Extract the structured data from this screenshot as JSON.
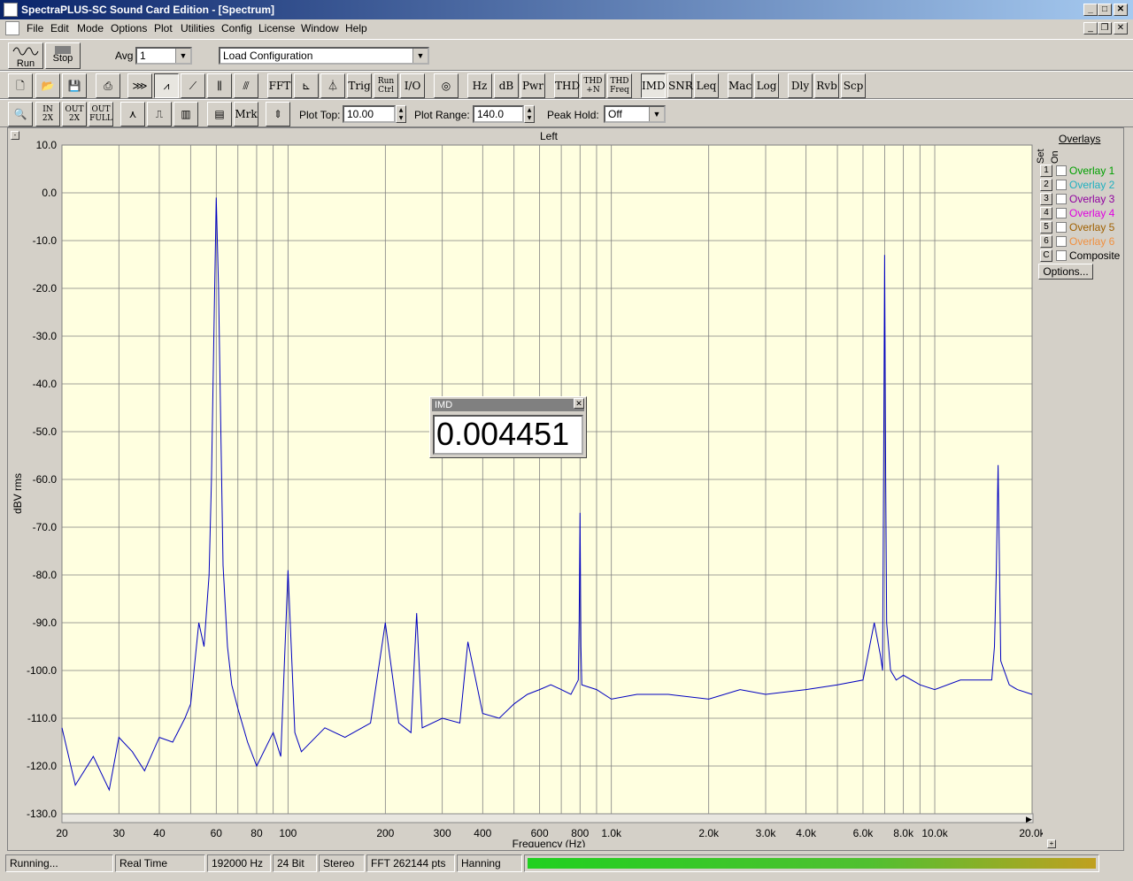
{
  "window": {
    "title": "SpectraPLUS-SC Sound Card Edition - [Spectrum]"
  },
  "menu": [
    "File",
    "Edit",
    "Mode",
    "Options",
    "Plot",
    "Utilities",
    "Config",
    "License",
    "Window",
    "Help"
  ],
  "toolbar1": {
    "run_label": "Run",
    "stop_label": "Stop",
    "avg_label": "Avg",
    "avg_value": "1",
    "config_value": "Load Configuration"
  },
  "toolbar2": {
    "fft": "FFT",
    "trig": "Trig",
    "run_ctrl_1": "Run",
    "run_ctrl_2": "Ctrl",
    "io": "I/O",
    "hz": "Hz",
    "db": "dB",
    "pwr": "Pwr",
    "thd": "THD",
    "thdn_1": "THD",
    "thdn_2": "+N",
    "thdf_1": "THD",
    "thdf_2": "Freq",
    "imd": "IMD",
    "snr": "SNR",
    "leq": "Leq",
    "mac": "Mac",
    "log": "Log",
    "dly": "Dly",
    "rvb": "Rvb",
    "scp": "Scp"
  },
  "toolbar3": {
    "zin_1": "IN",
    "zin_2": "2X",
    "zout_1": "OUT",
    "zout_2": "2X",
    "zfull_1": "OUT",
    "zfull_2": "FULL",
    "mrk": "Mrk",
    "plot_top_label": "Plot Top:",
    "plot_top_value": "10.00",
    "plot_range_label": "Plot Range:",
    "plot_range_value": "140.0",
    "peak_hold_label": "Peak Hold:",
    "peak_hold_value": "Off"
  },
  "overlays": {
    "title": "Overlays",
    "set_label": "Set",
    "on_label": "On",
    "items": [
      {
        "num": "1",
        "label": "Overlay 1",
        "color": "#00a000"
      },
      {
        "num": "2",
        "label": "Overlay 2",
        "color": "#20b0c0"
      },
      {
        "num": "3",
        "label": "Overlay 3",
        "color": "#9000a0"
      },
      {
        "num": "4",
        "label": "Overlay 4",
        "color": "#e000e0"
      },
      {
        "num": "5",
        "label": "Overlay 5",
        "color": "#a06000"
      },
      {
        "num": "6",
        "label": "Overlay 6",
        "color": "#f09040"
      },
      {
        "num": "C",
        "label": "Composite",
        "color": "#000000"
      }
    ],
    "options_label": "Options..."
  },
  "imd": {
    "title": "IMD",
    "value": "0.004451"
  },
  "status": {
    "state": "Running...",
    "mode": "Real Time",
    "rate": "192000 Hz",
    "bits": "24 Bit",
    "channels": "Stereo",
    "fft": "FFT 262144 pts",
    "window": "Hanning"
  },
  "chart_data": {
    "type": "line",
    "title": "Left",
    "xlabel": "Frequency (Hz)",
    "ylabel": "dBV rms",
    "xscale": "log",
    "xlim": [
      20,
      20000
    ],
    "ylim": [
      -130,
      10
    ],
    "grid": true,
    "line_color": "#0000c0",
    "background": "#ffffe0",
    "yticks": [
      10,
      0,
      -10,
      -20,
      -30,
      -40,
      -50,
      -60,
      -70,
      -80,
      -90,
      -100,
      -110,
      -120,
      -130
    ],
    "ytick_labels": [
      "10.0",
      "0.0",
      "-10.0",
      "-20.0",
      "-30.0",
      "-40.0",
      "-50.0",
      "-60.0",
      "-70.0",
      "-80.0",
      "-90.0",
      "-100.0",
      "-110.0",
      "-120.0",
      "-130.0"
    ],
    "xticks": [
      20,
      30,
      40,
      60,
      80,
      100,
      200,
      300,
      400,
      600,
      800,
      1000,
      2000,
      3000,
      4000,
      6000,
      8000,
      10000,
      20000
    ],
    "xtick_labels": [
      "20",
      "30",
      "40",
      "60",
      "80",
      "100",
      "200",
      "300",
      "400",
      "600",
      "800",
      "1.0k",
      "2.0k",
      "3.0k",
      "4.0k",
      "6.0k",
      "8.0k",
      "10.0k",
      "20.0k"
    ],
    "series": [
      {
        "x": [
          20,
          22,
          25,
          28,
          30,
          33,
          36,
          40,
          44,
          48,
          50,
          53,
          55,
          57,
          58,
          59,
          60,
          61,
          62,
          63,
          65,
          67,
          70,
          75,
          80,
          90,
          95,
          100,
          105,
          110,
          130,
          150,
          180,
          200,
          220,
          240,
          250,
          260,
          300,
          340,
          360,
          400,
          450,
          500,
          550,
          600,
          650,
          700,
          750,
          790,
          795,
          800,
          805,
          810,
          900,
          1000,
          1200,
          1500,
          2000,
          2500,
          3000,
          4000,
          5000,
          6000,
          6500,
          6800,
          6900,
          6950,
          7000,
          7050,
          7100,
          7300,
          7600,
          8000,
          9000,
          10000,
          12000,
          14000,
          15000,
          15300,
          15500,
          15700,
          16000,
          17000,
          18000,
          20000
        ],
        "y": [
          -112,
          -124,
          -118,
          -125,
          -114,
          -117,
          -121,
          -114,
          -115,
          -110,
          -107,
          -90,
          -95,
          -80,
          -60,
          -30,
          -1,
          -20,
          -50,
          -78,
          -95,
          -103,
          -108,
          -115,
          -120,
          -113,
          -118,
          -79,
          -113,
          -117,
          -112,
          -114,
          -111,
          -90,
          -111,
          -113,
          -88,
          -112,
          -110,
          -111,
          -94,
          -109,
          -110,
          -107,
          -105,
          -104,
          -103,
          -104,
          -105,
          -102,
          -90,
          -67,
          -95,
          -103,
          -104,
          -106,
          -105,
          -105,
          -106,
          -104,
          -105,
          -104,
          -103,
          -102,
          -90,
          -97,
          -100,
          -57,
          -13,
          -60,
          -90,
          -100,
          -102,
          -101,
          -103,
          -104,
          -102,
          -102,
          -102,
          -95,
          -79,
          -57,
          -98,
          -103,
          -104,
          -105
        ]
      }
    ]
  }
}
